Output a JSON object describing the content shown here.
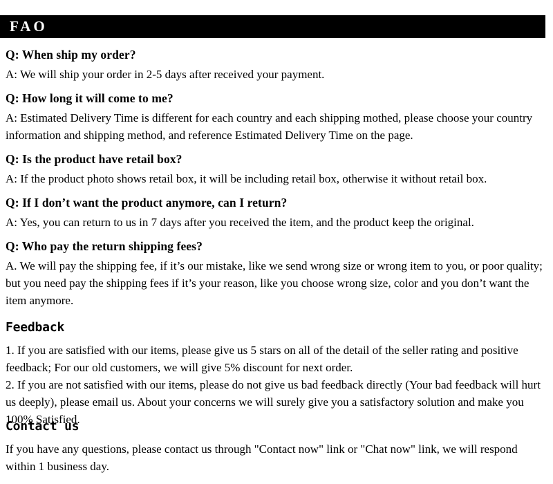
{
  "header": {
    "title": "FAO",
    "background_color": "#000000",
    "text_color": "#ffffff"
  },
  "faq": {
    "items": [
      {
        "question": "Q: When ship my order?",
        "answer": "A: We will ship your order in 2-5 days after received your payment."
      },
      {
        "question": "Q: How long it will come to me?",
        "answer": "A: Estimated Delivery Time is different for each country and each shipping mothed, please choose your country information and shipping method, and reference Estimated Delivery Time on the page."
      },
      {
        "question": "Q: Is the product have retail box?",
        "answer": "A: If  the product photo shows retail box, it will be including retail box, otherwise it without retail box."
      },
      {
        "question": "Q: If  I don’t want the product anymore, can I return?",
        "answer": "A: Yes, you can return to us in 7 days after you received the item, and the product keep the original."
      },
      {
        "question": "Q: Who pay the return shipping fees?",
        "answer": "A.  We will pay the shipping fee, if  it’s our mistake, like we send wrong size or wrong item to you, or poor quality; but you need pay the shipping fees if  it’s your reason, like you choose wrong size, color and you don’t want the item anymore."
      }
    ]
  },
  "feedback": {
    "heading": "Feedback",
    "items": [
      "1.  If you are satisfied with our items, please give us 5 stars on all of the detail of the seller rating and positive feedback; For our old customers, we will give 5% discount for next order.",
      "2.  If you are not satisfied with our items, please do not give us bad feedback directly (Your bad feedback will hurt us deeply), please email us. About your concerns we will surely give you a satisfactory solution and make you 100% Satisfied."
    ]
  },
  "contact": {
    "heading": "Contact us",
    "body": "If you have any questions, please contact us through \"Contact now\" link or \"Chat now\" link, we will respond within 1 business day."
  }
}
